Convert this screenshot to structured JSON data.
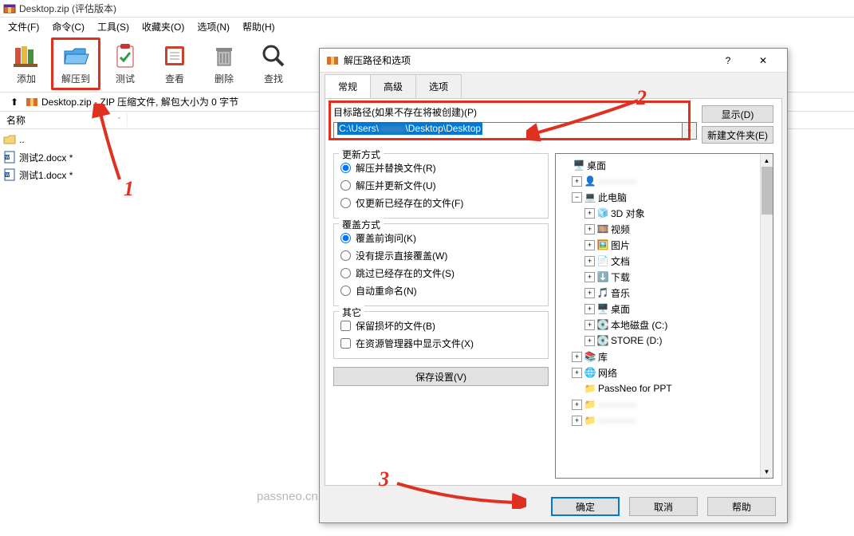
{
  "window": {
    "title": "Desktop.zip (评估版本)"
  },
  "menu": {
    "file": "文件(F)",
    "command": "命令(C)",
    "tool": "工具(S)",
    "fav": "收藏夹(O)",
    "option": "选项(N)",
    "help": "帮助(H)"
  },
  "toolbar": {
    "add": "添加",
    "extract": "解压到",
    "test": "测试",
    "view": "查看",
    "delete": "删除",
    "find": "查找"
  },
  "pathbar": {
    "text": "Desktop.zip - ZIP 压缩文件, 解包大小为 0 字节"
  },
  "listHeader": {
    "name": "名称"
  },
  "files": {
    "r0": "..",
    "r1": "测试2.docx *",
    "r2": "测试1.docx *"
  },
  "dialog": {
    "title": "解压路径和选项",
    "help_q": "?",
    "tabs": {
      "general": "常规",
      "advanced": "高级",
      "options": "选项"
    },
    "target_label": "目标路径(如果不存在将被创建)(P)",
    "target_prefix": "C:\\Users\\",
    "target_suffix": "\\Desktop\\Desktop",
    "btn_show": "显示(D)",
    "btn_newfolder": "新建文件夹(E)",
    "g_update": "更新方式",
    "u1": "解压并替换文件(R)",
    "u2": "解压并更新文件(U)",
    "u3": "仅更新已经存在的文件(F)",
    "g_overwrite": "覆盖方式",
    "o1": "覆盖前询问(K)",
    "o2": "没有提示直接覆盖(W)",
    "o3": "跳过已经存在的文件(S)",
    "o4": "自动重命名(N)",
    "g_misc": "其它",
    "m1": "保留损坏的文件(B)",
    "m2": "在资源管理器中显示文件(X)",
    "btn_save": "保存设置(V)",
    "btn_ok": "确定",
    "btn_cancel": "取消",
    "btn_help": "帮助"
  },
  "tree": {
    "desktop": "桌面",
    "user_blur": "————",
    "thispc": "此电脑",
    "obj3d": "3D 对象",
    "video": "视频",
    "pictures": "图片",
    "docs": "文档",
    "downloads": "下载",
    "music": "音乐",
    "desk2": "桌面",
    "localc": "本地磁盘 (C:)",
    "stored": "STORE (D:)",
    "lib": "库",
    "network": "网络",
    "passneo": "PassNeo for PPT",
    "blur1": "————",
    "blur2": "————"
  },
  "anno": {
    "n1": "1",
    "n2": "2",
    "n3": "3"
  },
  "watermark": "passneo.cn"
}
